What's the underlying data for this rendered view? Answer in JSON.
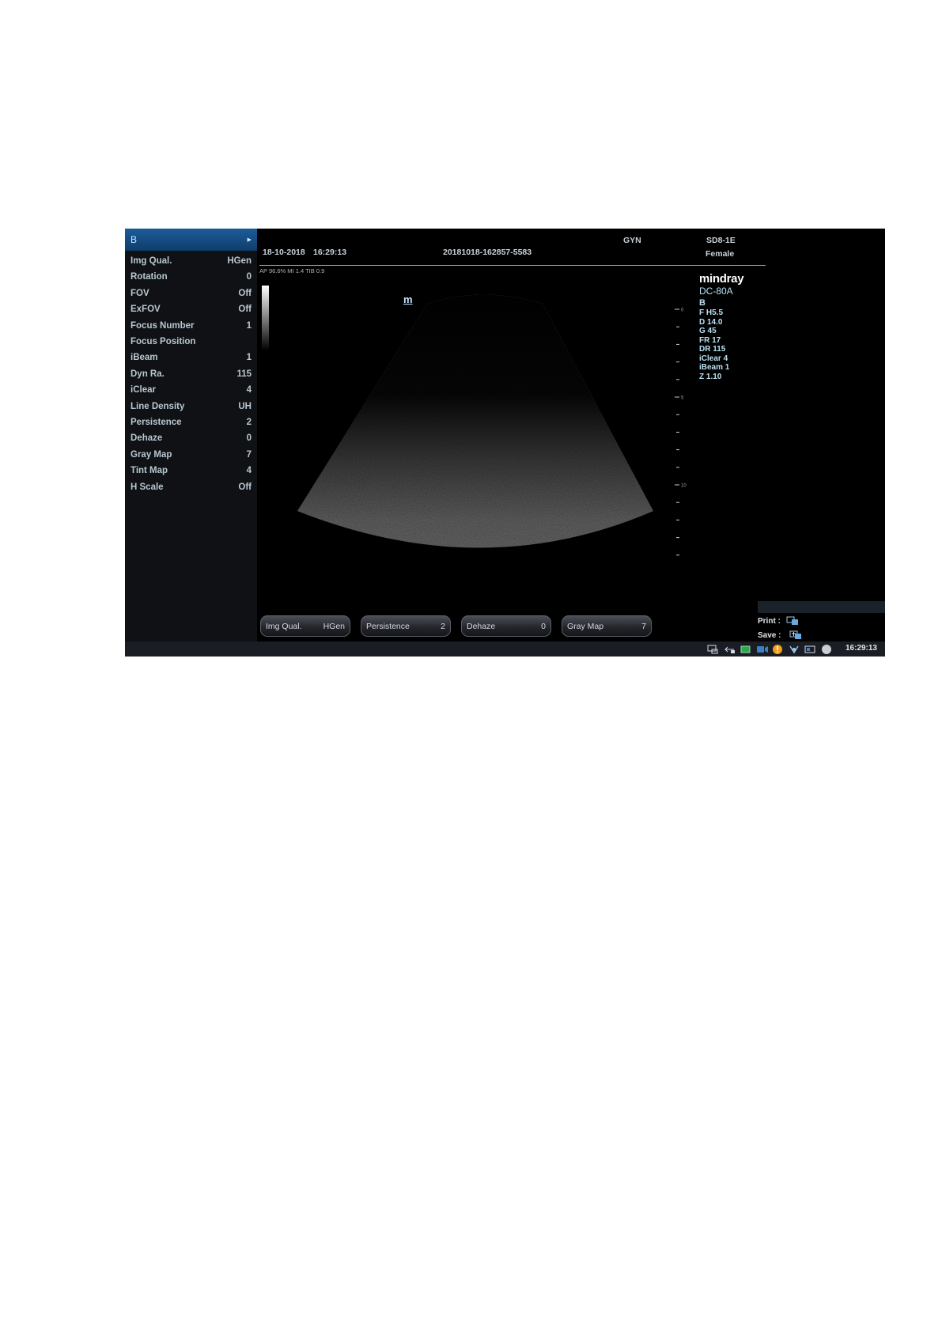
{
  "left_menu": {
    "header": "B",
    "items": [
      {
        "label": "Img Qual.",
        "value": "HGen"
      },
      {
        "label": "Rotation",
        "value": "0"
      },
      {
        "label": "FOV",
        "value": "Off"
      },
      {
        "label": "ExFOV",
        "value": "Off"
      },
      {
        "label": "Focus Number",
        "value": "1"
      },
      {
        "label": "Focus Position",
        "value": ""
      },
      {
        "label": "iBeam",
        "value": "1"
      },
      {
        "label": "Dyn Ra.",
        "value": "115"
      },
      {
        "label": "iClear",
        "value": "4"
      },
      {
        "label": "Line Density",
        "value": "UH"
      },
      {
        "label": "Persistence",
        "value": "2"
      },
      {
        "label": "Dehaze",
        "value": "0"
      },
      {
        "label": "Gray Map",
        "value": "7"
      },
      {
        "label": "Tint Map",
        "value": "4"
      },
      {
        "label": "H Scale",
        "value": "Off"
      }
    ]
  },
  "header": {
    "date": "18-10-2018",
    "time": "16:29:13",
    "exam_id": "20181018-162857-5583",
    "exam_type": "GYN",
    "probe": "SD8-1E",
    "patient_gender": "Female",
    "acoustic": "AP 96.6%  MI 1.4 TIB 0.9"
  },
  "image": {
    "marker": "m",
    "scale_labels": [
      "0",
      "5",
      "10"
    ]
  },
  "params": {
    "brand": "mindray",
    "model": "DC-80A",
    "mode": "B",
    "lines": [
      "F H5.5",
      "D 14.0",
      "G 45",
      "FR 17",
      "DR 115",
      "iClear 4",
      "iBeam 1",
      "Z 1.10"
    ]
  },
  "soft_buttons": [
    {
      "label": "Img Qual.",
      "value": "HGen"
    },
    {
      "label": "Persistence",
      "value": "2"
    },
    {
      "label": "Dehaze",
      "value": "0"
    },
    {
      "label": "Gray Map",
      "value": "7"
    }
  ],
  "print_save": {
    "print_label": "Print  :",
    "save_label": "Save  :"
  },
  "status_bar": {
    "clock": "16:29:13"
  },
  "colors": {
    "menu_header": "#1c5c9a",
    "param_text": "#b9e0f2",
    "status_orange": "#f0a020",
    "status_green": "#2aa84a"
  }
}
